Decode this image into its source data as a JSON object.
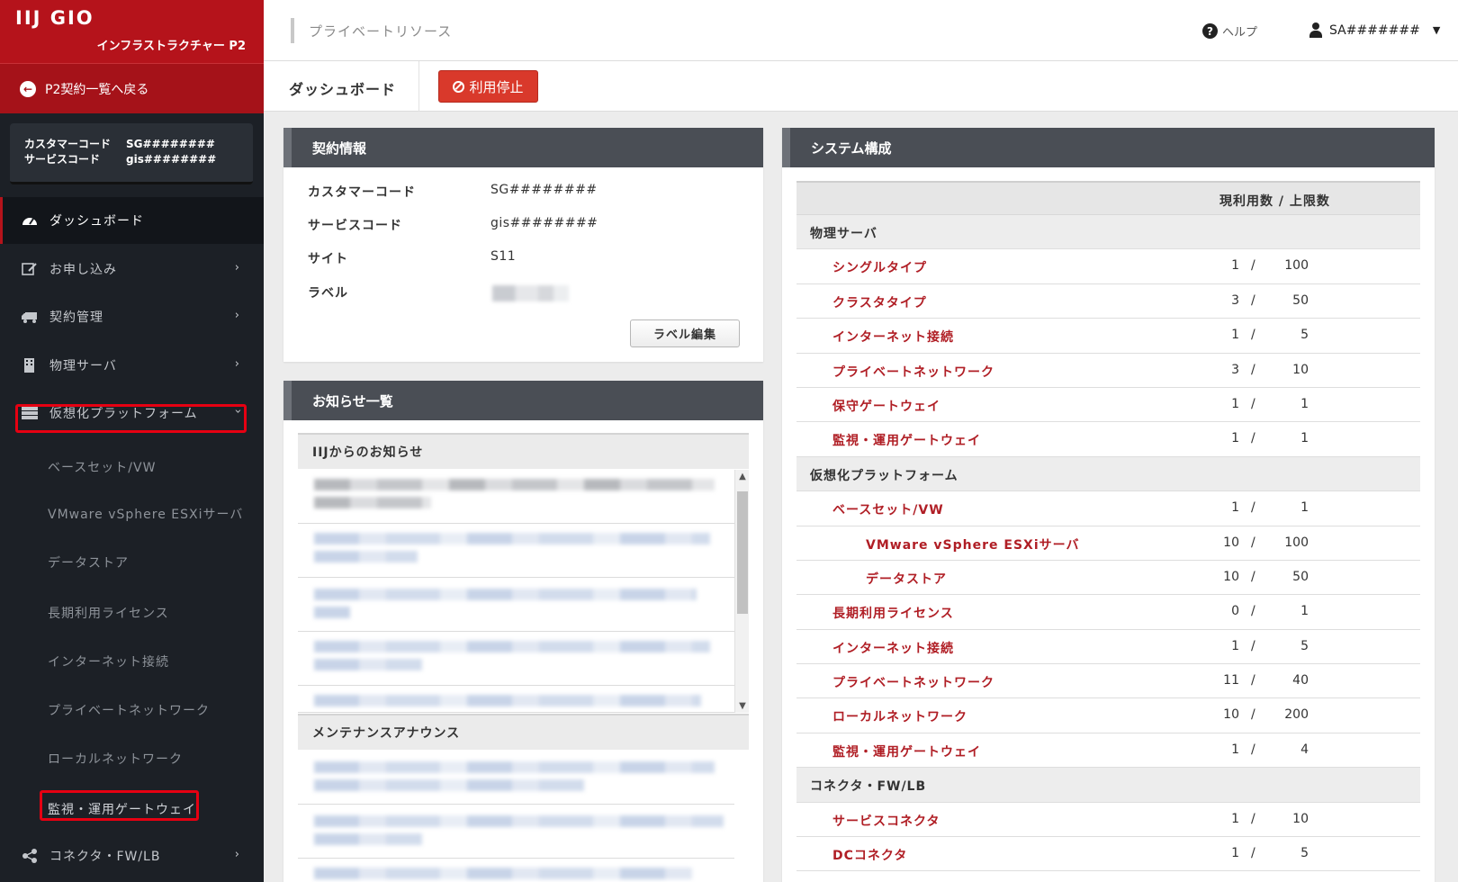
{
  "brand": {
    "logo": "IIJ GIO",
    "subtitle": "インフラストラクチャー P2"
  },
  "sidebar": {
    "back_link": "P2契約一覧へ戻る",
    "codes": [
      {
        "key": "カスタマーコード",
        "value": "SG########"
      },
      {
        "key": "サービスコード",
        "value": "gis########"
      }
    ],
    "nav": [
      {
        "label": "ダッシュボード",
        "icon": "dashboard-icon",
        "active": true
      },
      {
        "label": "お申し込み",
        "icon": "edit-icon"
      },
      {
        "label": "契約管理",
        "icon": "truck-icon"
      },
      {
        "label": "物理サーバ",
        "icon": "server-icon"
      },
      {
        "label": "仮想化プラットフォーム",
        "icon": "stack-icon",
        "expanded": true
      },
      {
        "label": "コネクタ・FW/LB",
        "icon": "share-icon"
      }
    ],
    "subnav": [
      "ベースセット/VW",
      "VMware vSphere ESXiサーバ",
      "データストア",
      "長期利用ライセンス",
      "インターネット接続",
      "プライベートネットワーク",
      "ローカルネットワーク",
      "監視・運用ゲートウェイ"
    ],
    "highlight_color": "#e60012"
  },
  "header": {
    "breadcrumb": "プライベートリソース",
    "help": "ヘルプ",
    "user": "SA#######"
  },
  "tabbar": {
    "tab": "ダッシュボード",
    "stop_button": "利用停止"
  },
  "contract": {
    "title": "契約情報",
    "rows": [
      {
        "key": "カスタマーコード",
        "value": "SG########"
      },
      {
        "key": "サービスコード",
        "value": "gis########"
      },
      {
        "key": "サイト",
        "value": "S11"
      },
      {
        "key": "ラベル",
        "value": ""
      }
    ],
    "edit_button": "ラベル編集"
  },
  "news": {
    "title": "お知らせ一覧",
    "section1": "IIJからのお知らせ",
    "section2": "メンテナンスアナウンス"
  },
  "system": {
    "title": "システム構成",
    "column_header": "現利用数 / 上限数",
    "rows": [
      {
        "type": "cat",
        "name": "物理サーバ"
      },
      {
        "name": "シングルタイプ",
        "indent": 1,
        "cur": "1",
        "max": "100"
      },
      {
        "name": "クラスタタイプ",
        "indent": 1,
        "cur": "3",
        "max": "50"
      },
      {
        "name": "インターネット接続",
        "indent": 1,
        "cur": "1",
        "max": "5"
      },
      {
        "name": "プライベートネットワーク",
        "indent": 1,
        "cur": "3",
        "max": "10"
      },
      {
        "name": "保守ゲートウェイ",
        "indent": 1,
        "cur": "1",
        "max": "1"
      },
      {
        "name": "監視・運用ゲートウェイ",
        "indent": 1,
        "cur": "1",
        "max": "1"
      },
      {
        "type": "cat",
        "name": "仮想化プラットフォーム"
      },
      {
        "name": "ベースセット/VW",
        "indent": 1,
        "cur": "1",
        "max": "1"
      },
      {
        "name": "VMware vSphere ESXiサーバ",
        "indent": 2,
        "cur": "10",
        "max": "100"
      },
      {
        "name": "データストア",
        "indent": 2,
        "cur": "10",
        "max": "50"
      },
      {
        "name": "長期利用ライセンス",
        "indent": 1,
        "cur": "0",
        "max": "1"
      },
      {
        "name": "インターネット接続",
        "indent": 1,
        "cur": "1",
        "max": "5"
      },
      {
        "name": "プライベートネットワーク",
        "indent": 1,
        "cur": "11",
        "max": "40"
      },
      {
        "name": "ローカルネットワーク",
        "indent": 1,
        "cur": "10",
        "max": "200"
      },
      {
        "name": "監視・運用ゲートウェイ",
        "indent": 1,
        "cur": "1",
        "max": "4"
      },
      {
        "type": "cat",
        "name": "コネクタ・FW/LB"
      },
      {
        "name": "サービスコネクタ",
        "indent": 1,
        "cur": "1",
        "max": "10"
      },
      {
        "name": "DCコネクタ",
        "indent": 1,
        "cur": "1",
        "max": "5"
      }
    ]
  },
  "colors": {
    "brand_red": "#b5131b",
    "link_red": "#b01e25",
    "sidebar_bg": "#1c2026",
    "stop_button": "#d9392b"
  }
}
